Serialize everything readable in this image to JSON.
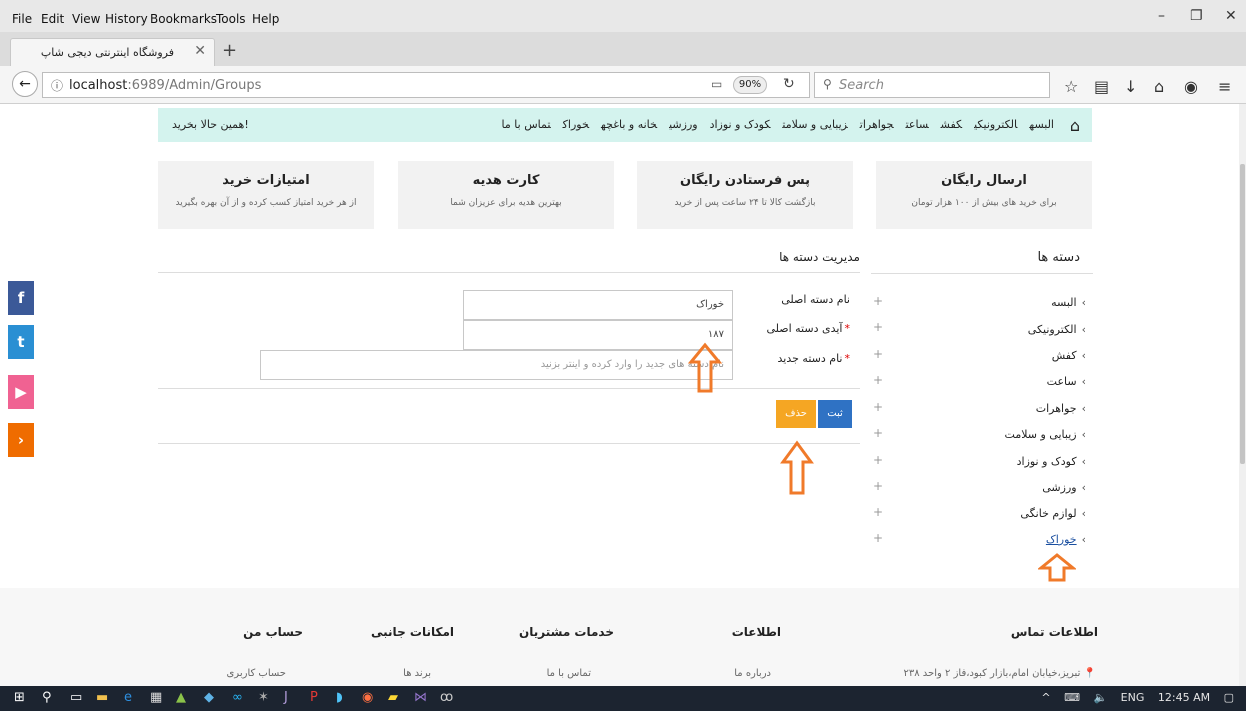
{
  "menubar": {
    "items": [
      {
        "label": "File",
        "u": "F"
      },
      {
        "label": "Edit",
        "u": "E"
      },
      {
        "label": "View",
        "u": "V"
      },
      {
        "label": "History",
        "u": "s"
      },
      {
        "label": "Bookmarks",
        "u": "B"
      },
      {
        "label": "Tools",
        "u": "T"
      },
      {
        "label": "Help",
        "u": "H"
      }
    ],
    "window_controls": [
      "–",
      "❐",
      "✕"
    ]
  },
  "tab": {
    "title": "فروشگاه اینترنتی دیجی شاپ",
    "close": "✕",
    "new_tab": "+"
  },
  "navbar": {
    "url_host": "localhost",
    "url_path": ":6989/Admin/Groups",
    "zoom": "90%",
    "search_placeholder": "Search"
  },
  "site_nav": {
    "links": [
      "البسه",
      "الکترونیکی",
      "کفش",
      "ساعت",
      "جواهرات",
      "زیبایی و سلامت",
      "کودک و نوزاد",
      "ورزشی",
      "خانه و باغچه",
      "خوراک",
      "تماس با ما"
    ],
    "buy_now": "همین حالا بخرید!"
  },
  "features": [
    {
      "title": "ارسال رایگان",
      "desc": "برای خرید های بیش از ۱۰۰ هزار تومان"
    },
    {
      "title": "پس فرستادن رایگان",
      "desc": "بازگشت کالا تا ۲۴ ساعت پس از خرید"
    },
    {
      "title": "کارت هدیه",
      "desc": "بهترین هدیه برای عزیزان شما"
    },
    {
      "title": "امتیازات خرید",
      "desc": "از هر خرید امتیاز کسب کرده و از آن بهره بگیرید"
    }
  ],
  "categories": {
    "title": "دسته ها",
    "items": [
      "البسه",
      "الکترونیکی",
      "کفش",
      "ساعت",
      "جواهرات",
      "زیبایی و سلامت",
      "کودک و نوزاد",
      "ورزشی",
      "لوازم خانگی",
      "خوراک"
    ],
    "active_index": 9
  },
  "management": {
    "title": "مدیریت دسته ها",
    "labels": {
      "parent_name": "نام دسته اصلی",
      "parent_id": "آیدی دسته اصلی",
      "new_name": "نام دسته جدید"
    },
    "values": {
      "parent_name": "خوراک",
      "parent_id": "۱۸۷"
    },
    "new_name_placeholder": "نام دسته های جدید را وارد کرده و اینتر بزنید",
    "submit_label": "ثبت",
    "delete_label": "حذف"
  },
  "social": {
    "facebook": "f",
    "twitter": "t",
    "youtube": "▶",
    "share": "›"
  },
  "footer": {
    "columns": [
      {
        "title": "اطلاعات تماس",
        "link": "تبریز،خیابان امام،بازار کبود،فاز ۲ واحد ۲۳۸"
      },
      {
        "title": "اطلاعات",
        "link": "درباره ما"
      },
      {
        "title": "خدمات مشتریان",
        "link": "تماس با ما"
      },
      {
        "title": "امکانات جانبی",
        "link": "برند ها"
      },
      {
        "title": "حساب من",
        "link": "حساب کاربری"
      }
    ]
  },
  "taskbar": {
    "lang": "ENG",
    "time": "12:45 AM"
  },
  "colors": {
    "nav_bg": "#d4f3ee",
    "submit": "#2f72c4",
    "delete": "#f5a623",
    "arrow": "#f07a2a",
    "facebook": "#3b5998",
    "twitter": "#2a8fd3",
    "youtube": "#f06292",
    "share": "#ef6c00"
  }
}
